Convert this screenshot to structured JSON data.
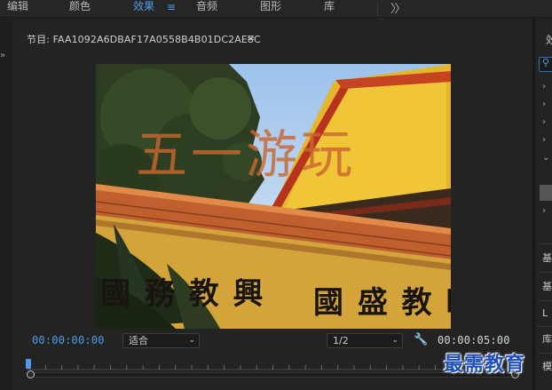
{
  "workspace_tabs": [
    {
      "label": "编辑",
      "active": false
    },
    {
      "label": "颜色",
      "active": false
    },
    {
      "label": "效果",
      "active": true
    },
    {
      "label": "音频",
      "active": false
    },
    {
      "label": "图形",
      "active": false
    },
    {
      "label": "库",
      "active": false
    }
  ],
  "program_monitor": {
    "title": "节目: FAA1092A6DBAF17A0558B4B01DC2AE8C",
    "menu_glyph": "≡",
    "overlay_title": "五一游玩",
    "sign_left": "國 務 教 興",
    "sign_right": "國 盛 教 旺",
    "current_timecode": "00:00:00:00",
    "duration_timecode": "00:00:05:00",
    "zoom": {
      "value": "适合"
    },
    "resolution": {
      "value": "1/2"
    }
  },
  "right_panel": {
    "title_glyph": "效",
    "items": [
      "基",
      "基",
      "L",
      "库",
      "模"
    ]
  },
  "watermark": "最需教育",
  "colors": {
    "accent": "#4e9ce8",
    "panel_bg": "#232323",
    "overlay_text": "#c8662f"
  },
  "icons": {
    "overflow": "double-chevron-right-icon",
    "menu": "hamburger-menu-icon",
    "settings": "wrench-icon",
    "search": "search-icon"
  }
}
